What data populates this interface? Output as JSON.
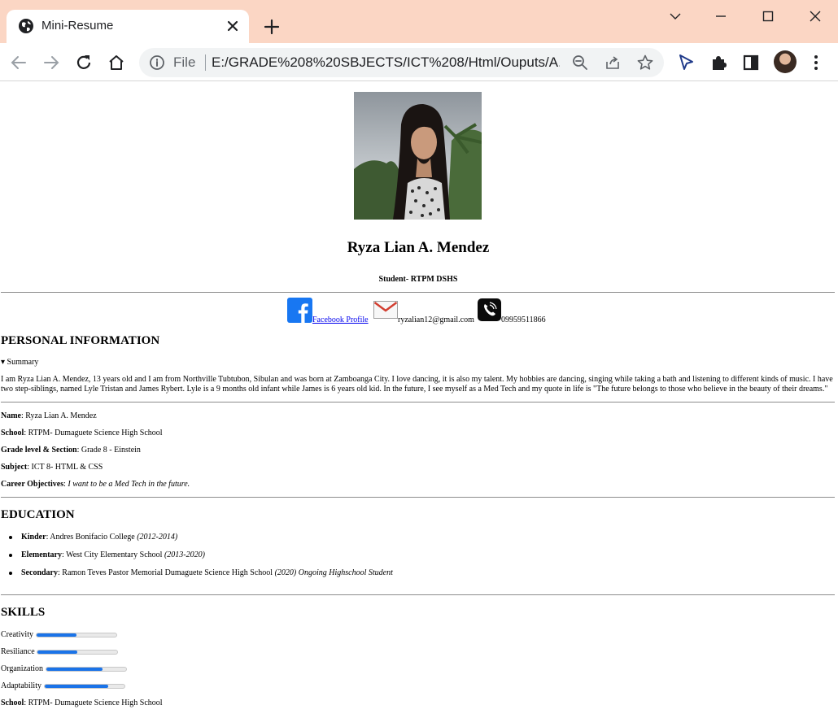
{
  "browser": {
    "tab_title": "Mini-Resume",
    "file_label": "File",
    "url": "E:/GRADE%208%20SBJECTS/ICT%208/Html/Ouputs/A...",
    "icons": [
      "globe-icon",
      "close-icon",
      "plus-icon",
      "chevron-down-icon",
      "minimize-icon",
      "maximize-icon",
      "close-window-icon",
      "back-icon",
      "forward-icon",
      "reload-icon",
      "home-icon",
      "info-icon",
      "zoom-out-icon",
      "share-icon",
      "star-icon",
      "cursor-icon",
      "extensions-icon",
      "side-panel-icon",
      "profile-avatar",
      "more-icon"
    ]
  },
  "resume": {
    "name": "Ryza Lian A. Mendez",
    "role": "Student- RTPM DSHS",
    "contacts": {
      "facebook": " Facebook Profile ",
      "email": "ryzalian12@gmail.com",
      "phone": " 09959511866"
    },
    "personal": {
      "heading": "PERSONAL INFORMATION",
      "summary_toggle": "▾  Summary",
      "summary_text": "I am Ryza Lian A. Mendez, 13 years old and I am from Northville Tubtubon, Sibulan and was born at Zamboanga City. I love dancing, it is also my talent. My hobbies are dancing, singing while taking a bath and listening to different kinds of music. I have two step-siblings, named Lyle Tristan and James Rybert. Lyle is a 9 months old infant while James is 6 years old kid. In the future, I see myself as a Med Tech and my quote in life is \"The future belongs to those who believe in the beauty of their dreams.\"",
      "fields": [
        {
          "label": "Name",
          "value": " Ryza Lian A. Mendez"
        },
        {
          "label": "School",
          "value": " RTPM- Dumaguete Science High School"
        },
        {
          "label": "Grade level & Section",
          "value": " Grade 8 - Einstein"
        },
        {
          "label": "Subject",
          "value": " ICT 8- HTML & CSS"
        },
        {
          "label": "Career Objectives",
          "value": " I want to be a Med Tech in the future."
        }
      ]
    },
    "education": {
      "heading": "EDUCATION",
      "items": [
        {
          "label": "Kinder",
          "school": " Andres Bonifacio College ",
          "years": "(2012-2014)",
          "note": ""
        },
        {
          "label": "Elementary",
          "school": " West City Elementary School ",
          "years": "(2013-2020)",
          "note": ""
        },
        {
          "label": "Secondary",
          "school": " Ramon Teves Pastor Memorial Dumaguete Science High School ",
          "years": "(2020)",
          "note": " Ongoing Highschool Student"
        }
      ]
    },
    "skills": {
      "heading": "SKILLS",
      "items": [
        {
          "label": "Creativity",
          "level": 0.5
        },
        {
          "label": "Resiliance",
          "level": 0.5
        },
        {
          "label": "Organization",
          "level": 0.7
        },
        {
          "label": "Adaptability",
          "level": 0.8
        }
      ],
      "footer_label": "School",
      "footer_value": " RTPM- Dumaguete Science High School"
    }
  },
  "colors": {
    "tabstrip": "#fbd6c4",
    "link": "#0000ee",
    "progress": "#1a73e8"
  }
}
